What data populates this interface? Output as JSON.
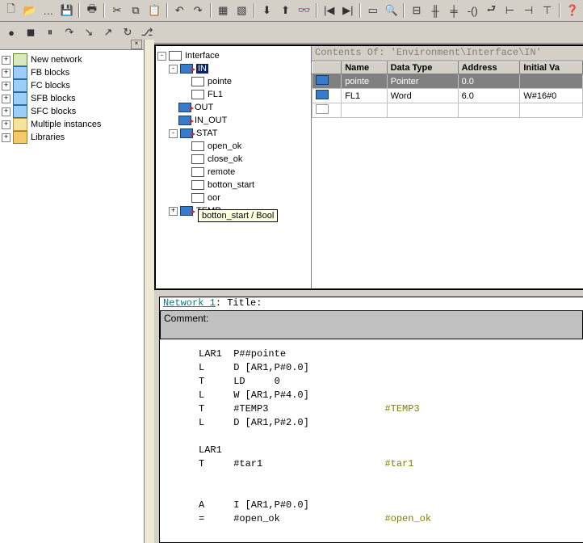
{
  "toolbars": {
    "row1": [
      "new",
      "open",
      "…",
      "save",
      "",
      "print",
      "",
      "cut",
      "copy",
      "paste",
      "",
      "undo",
      "redo",
      "",
      "obj",
      "lib",
      "",
      "dnld",
      "upld",
      "glasses",
      "",
      "nav1",
      "nav2",
      "",
      "win-tile",
      "win-find",
      "",
      "m1",
      "m2",
      "m3",
      "m4",
      "m5",
      "m6",
      "m7",
      "m8",
      "",
      "help-cursor"
    ],
    "row2": [
      "rec",
      "stop",
      "pause",
      "step-over",
      "step-in",
      "step-out",
      "restart",
      "branch"
    ]
  },
  "nav": {
    "items": [
      {
        "label": "New network",
        "icon": "net"
      },
      {
        "label": "FB blocks",
        "icon": "blocks"
      },
      {
        "label": "FC blocks",
        "icon": "blocks"
      },
      {
        "label": "SFB blocks",
        "icon": "blocks"
      },
      {
        "label": "SFC blocks",
        "icon": "blocks"
      },
      {
        "label": "Multiple instances",
        "icon": "folder"
      },
      {
        "label": "Libraries",
        "icon": "lib"
      }
    ]
  },
  "iface": {
    "root": "Interface",
    "in": {
      "label": "IN",
      "children": [
        "pointe",
        "FL1"
      ]
    },
    "out": "OUT",
    "inout": "IN_OUT",
    "stat": {
      "label": "STAT",
      "children": [
        "open_ok",
        "close_ok",
        "remote",
        "botton_start"
      ]
    },
    "stat_extra": "oor",
    "temp": "TEMP",
    "tooltip": "botton_start / Bool"
  },
  "contents": {
    "title": "Contents Of: 'Environment\\Interface\\IN'",
    "headers": [
      "",
      "Name",
      "Data Type",
      "Address",
      "Initial Va"
    ],
    "rows": [
      {
        "name": "pointe",
        "type": "Pointer",
        "addr": "0.0",
        "init": ""
      },
      {
        "name": "FL1",
        "type": "Word",
        "addr": "6.0",
        "init": "W#16#0"
      }
    ]
  },
  "code": {
    "network_label": "Network 1",
    "network_suffix": ": Title:",
    "comment_label": "Comment:",
    "lines": [
      {
        "t": "LAR1  P##pointe"
      },
      {
        "t": "L     D [AR1,P#0.0]"
      },
      {
        "t": "T     LD     0"
      },
      {
        "t": "L     W [AR1,P#4.0]"
      },
      {
        "t": "T     #TEMP3",
        "s": "#TEMP3"
      },
      {
        "t": "L     D [AR1,P#2.0]"
      },
      {
        "t": ""
      },
      {
        "t": "LAR1"
      },
      {
        "t": "T     #tar1",
        "s": "#tar1"
      },
      {
        "t": ""
      },
      {
        "t": ""
      },
      {
        "t": "A     I [AR1,P#0.0]"
      },
      {
        "t": "=     #open_ok",
        "s": "#open_ok"
      }
    ]
  }
}
